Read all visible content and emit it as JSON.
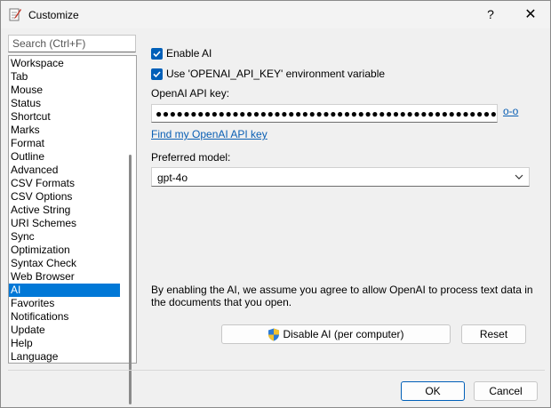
{
  "window": {
    "title": "Customize",
    "help_glyph": "?",
    "close_glyph": "✕"
  },
  "search": {
    "placeholder": "Search (Ctrl+F)"
  },
  "nav": {
    "items": [
      "Workspace",
      "Tab",
      "Mouse",
      "Status",
      "Shortcut",
      "Marks",
      "Format",
      "Outline",
      "Advanced",
      "CSV Formats",
      "CSV Options",
      "Active String",
      "URI Schemes",
      "Sync",
      "Optimization",
      "Syntax Check",
      "Web Browser",
      "AI",
      "Favorites",
      "Notifications",
      "Update",
      "Help",
      "Language"
    ],
    "selected": "AI"
  },
  "ai": {
    "enable_label": "Enable AI",
    "env_label": "Use 'OPENAI_API_KEY' environment variable",
    "api_key_label": "OpenAI API key:",
    "api_key_value": "●●●●●●●●●●●●●●●●●●●●●●●●●●●●●●●●●●●●●●●●●●●●●●●●●●●●●●●●",
    "reveal_label": "o-o",
    "find_link": "Find my OpenAI API key",
    "model_label": "Preferred model:",
    "model_value": "gpt-4o",
    "notice": "By enabling the AI, we assume you agree to allow OpenAI to process text data in the documents that you open.",
    "disable_button": "Disable AI (per computer)",
    "reset_button": "Reset"
  },
  "footer": {
    "ok": "OK",
    "cancel": "Cancel"
  },
  "colors": {
    "accent": "#005fb8",
    "selection": "#0078d7",
    "link": "#0a5fb4"
  }
}
